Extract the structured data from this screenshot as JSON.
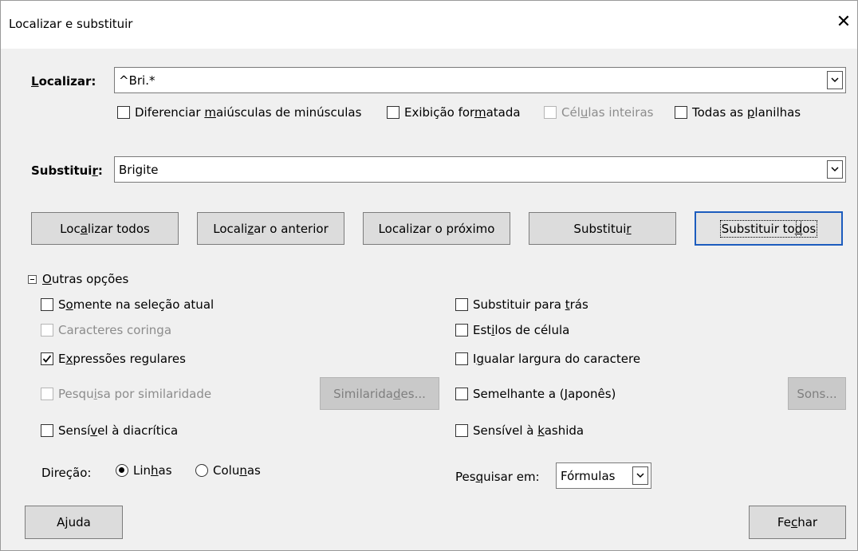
{
  "window": {
    "title": "Localizar e substituir",
    "close_glyph": "✕"
  },
  "find": {
    "label_pre": "",
    "label_u": "L",
    "label_post": "ocalizar:",
    "value": "^Bri.*",
    "options": [
      {
        "pre": "Diferenciar ",
        "u": "m",
        "post": "aiúsculas de minúsculas",
        "checked": false,
        "disabled": false
      },
      {
        "pre": "Exibição for",
        "u": "m",
        "post": "atada",
        "checked": false,
        "disabled": false
      },
      {
        "pre": "Cél",
        "u": "u",
        "post": "las inteiras",
        "checked": false,
        "disabled": true
      },
      {
        "pre": "Todas as ",
        "u": "p",
        "post": "lanilhas",
        "checked": false,
        "disabled": false
      }
    ]
  },
  "replace": {
    "label_pre": "Substitui",
    "label_u": "r",
    "label_post": ":",
    "value": "Brigite"
  },
  "buttons": {
    "find_all": {
      "pre": "Loc",
      "u": "a",
      "post": "lizar todos"
    },
    "find_prev": {
      "pre": "Locali",
      "u": "z",
      "post": "ar o anterior"
    },
    "find_next": {
      "pre": "Localizar o próximo",
      "u": "",
      "post": ""
    },
    "replace": {
      "pre": "Substitui",
      "u": "r",
      "post": ""
    },
    "replace_all": {
      "pre": "Substituir to",
      "u": "d",
      "post": "os"
    }
  },
  "other_options": {
    "header_pre": "",
    "header_u": "O",
    "header_post": "utras opções",
    "left": [
      {
        "pre": "S",
        "u": "o",
        "post": "mente na seleção atual",
        "checked": false,
        "disabled": false
      },
      {
        "pre": "Caracteres corin",
        "u": "g",
        "post": "a",
        "checked": false,
        "disabled": true
      },
      {
        "pre": "E",
        "u": "x",
        "post": "pressões regulares",
        "checked": true,
        "disabled": false
      },
      {
        "pre": "Pesqu",
        "u": "i",
        "post": "sa por similaridade",
        "checked": false,
        "disabled": true
      },
      {
        "pre": "Sensí",
        "u": "v",
        "post": "el à diacrítica",
        "checked": false,
        "disabled": false
      }
    ],
    "right": [
      {
        "pre": "Substituir para ",
        "u": "t",
        "post": "rás",
        "checked": false,
        "disabled": false
      },
      {
        "pre": "Est",
        "u": "i",
        "post": "los de célula",
        "checked": false,
        "disabled": false
      },
      {
        "pre": "I",
        "u": "g",
        "post": "ualar largura do caractere",
        "checked": false,
        "disabled": false
      },
      {
        "pre": "Semelhante a (",
        "u": "J",
        "post": "aponês)",
        "checked": false,
        "disabled": false
      },
      {
        "pre": "Sensível à ",
        "u": "k",
        "post": "ashida",
        "checked": false,
        "disabled": false
      }
    ],
    "similarities_btn": {
      "pre": "Similarida",
      "u": "d",
      "post": "es..."
    },
    "sounds_btn": "Sons...",
    "direction": {
      "label": "Direção:",
      "rows": {
        "pre": "Lin",
        "u": "h",
        "post": "as",
        "selected": true
      },
      "cols": {
        "pre": "Colu",
        "u": "n",
        "post": "as",
        "selected": false
      }
    },
    "search_in": {
      "label_pre": "Pes",
      "label_u": "q",
      "label_post": "uisar em:",
      "value": "Fórmulas"
    }
  },
  "footer": {
    "help": {
      "pre": "A",
      "u": "j",
      "post": "uda"
    },
    "close": {
      "pre": "Fe",
      "u": "c",
      "post": "har"
    }
  },
  "colors": {
    "accent": "#1c5cbe",
    "background": "#f0f0f0"
  }
}
